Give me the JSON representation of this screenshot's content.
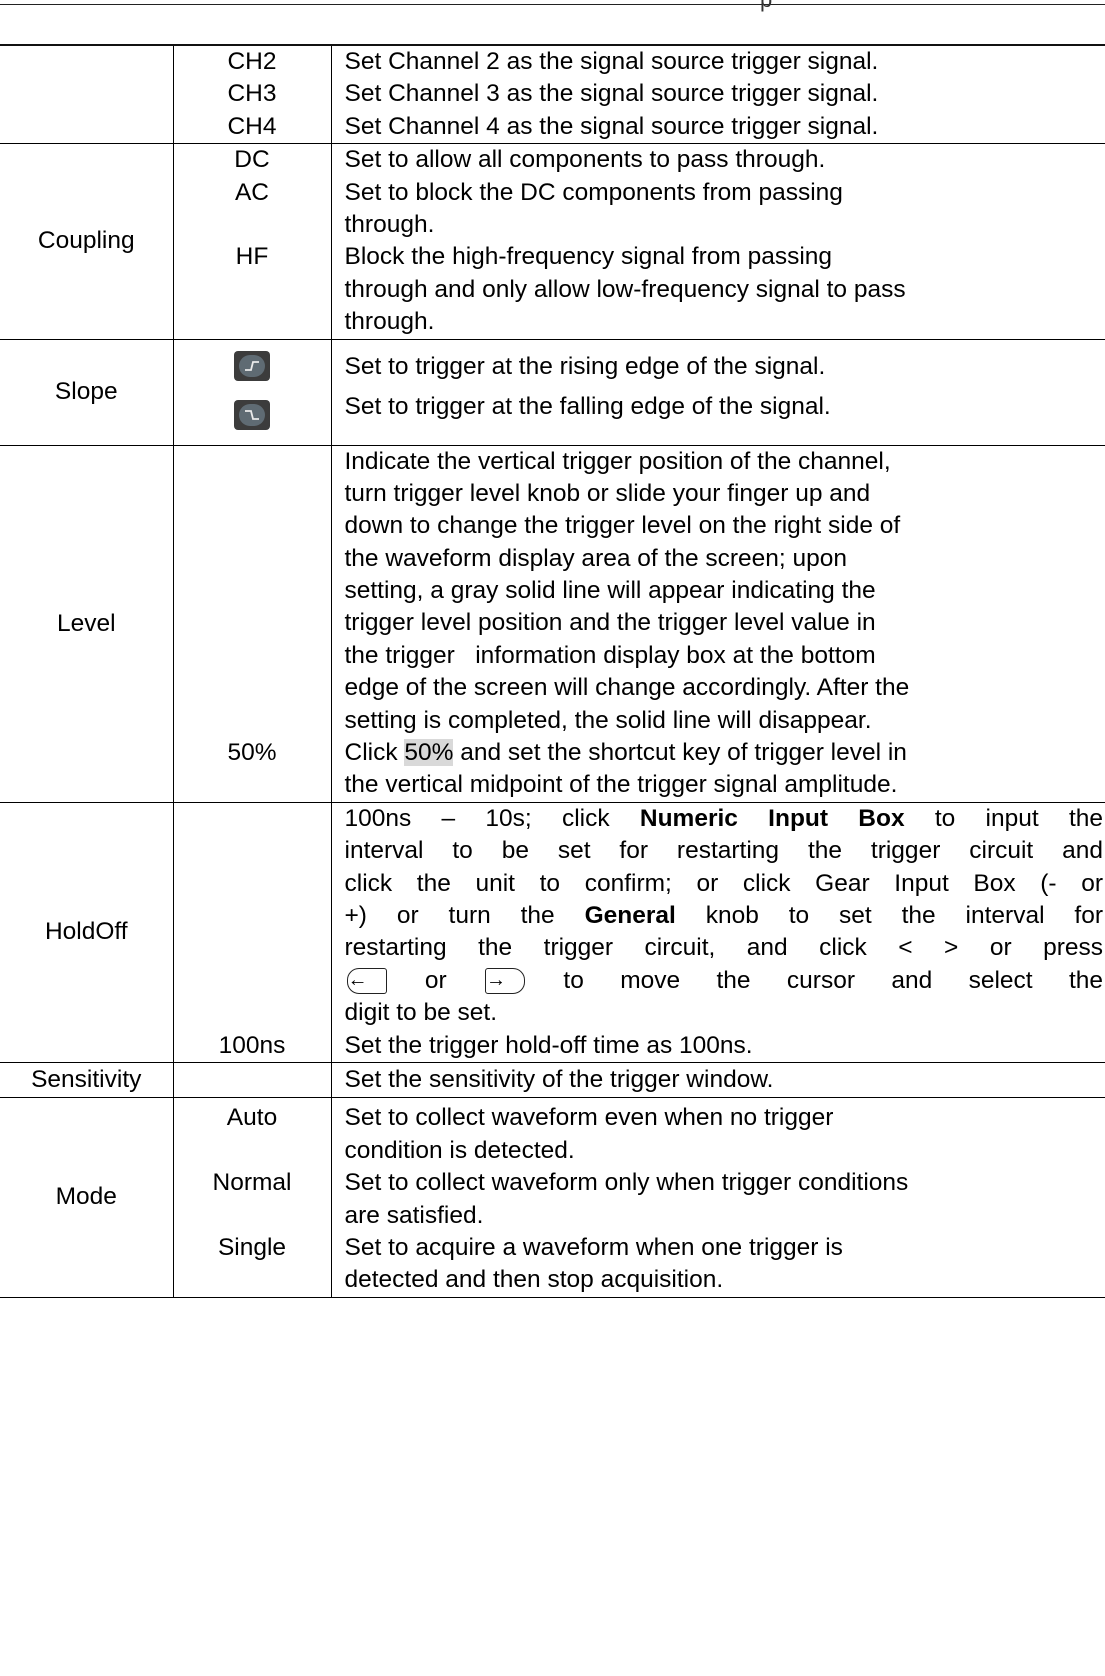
{
  "header": {
    "fragment": "p"
  },
  "rows": {
    "source": {
      "opt": [
        "CH2",
        "CH3",
        "CH4"
      ],
      "desc": [
        "Set Channel 2 as the signal source trigger signal.",
        "Set Channel 3 as the signal source trigger signal.",
        "Set Channel 4 as the signal source trigger signal."
      ]
    },
    "coupling": {
      "param": "Coupling",
      "opt": [
        "DC",
        "AC",
        "HF"
      ],
      "desc": [
        "Set to allow all components to pass through.",
        "Set to block the DC components from passing",
        "through.",
        "Block the high-frequency signal from passing",
        "through and only allow low-frequency signal to pass",
        "through."
      ]
    },
    "slope": {
      "param": "Slope",
      "opt_icons": [
        "rising-edge-icon",
        "falling-edge-icon"
      ],
      "desc": [
        "Set to trigger at the rising edge of the signal.",
        "Set to trigger at the falling edge of the signal."
      ]
    },
    "level": {
      "param": "Level",
      "opt": "50%",
      "desc": [
        "Indicate the vertical trigger position of the channel,",
        "turn trigger level knob or slide your finger up and",
        "down to change the trigger level on the right side of",
        "the waveform display area of the screen; upon",
        "setting, a gray solid line will appear indicating the",
        "trigger level position and the trigger level value in",
        "the trigger   information display box at the bottom",
        "edge of the screen will change accordingly. After the",
        "setting is completed, the solid line will disappear."
      ],
      "desc_50_pre": "Click ",
      "desc_50_hl": "50%",
      "desc_50_post": " and set the shortcut key of trigger level in",
      "desc_50_line2": "the vertical midpoint of the trigger signal amplitude."
    },
    "holdoff": {
      "param": "HoldOff",
      "opt": "100ns",
      "l1_pre": "100ns – 10s; click ",
      "l1_bold": "Numeric Input Box",
      "l1_post": " to input the",
      "l2": "interval to be set for restarting the trigger circuit and",
      "l3": "click the unit to confirm; or click Gear Input Box (- or",
      "l4_pre": "+) or turn the ",
      "l4_bold": "General",
      "l4_post": " knob to set the interval for",
      "l5": "restarting the trigger circuit, and click < > or press",
      "l6_or": "or",
      "l6_post": "to move the cursor and select the",
      "l7": "digit to be set.",
      "l8": "Set the trigger hold-off time as 100ns.",
      "key_left": "←",
      "key_right": "→"
    },
    "sensitivity": {
      "param": "Sensitivity",
      "desc": "Set the sensitivity of the trigger window."
    },
    "mode": {
      "param": "Mode",
      "opt": [
        "Auto",
        "Normal",
        "Single"
      ],
      "desc": [
        "Set to collect waveform even when no trigger",
        "condition is detected.",
        "Set to collect waveform only when trigger conditions",
        "are satisfied.",
        "Set to acquire a waveform when one trigger is",
        "detected and then stop acquisition."
      ]
    }
  }
}
